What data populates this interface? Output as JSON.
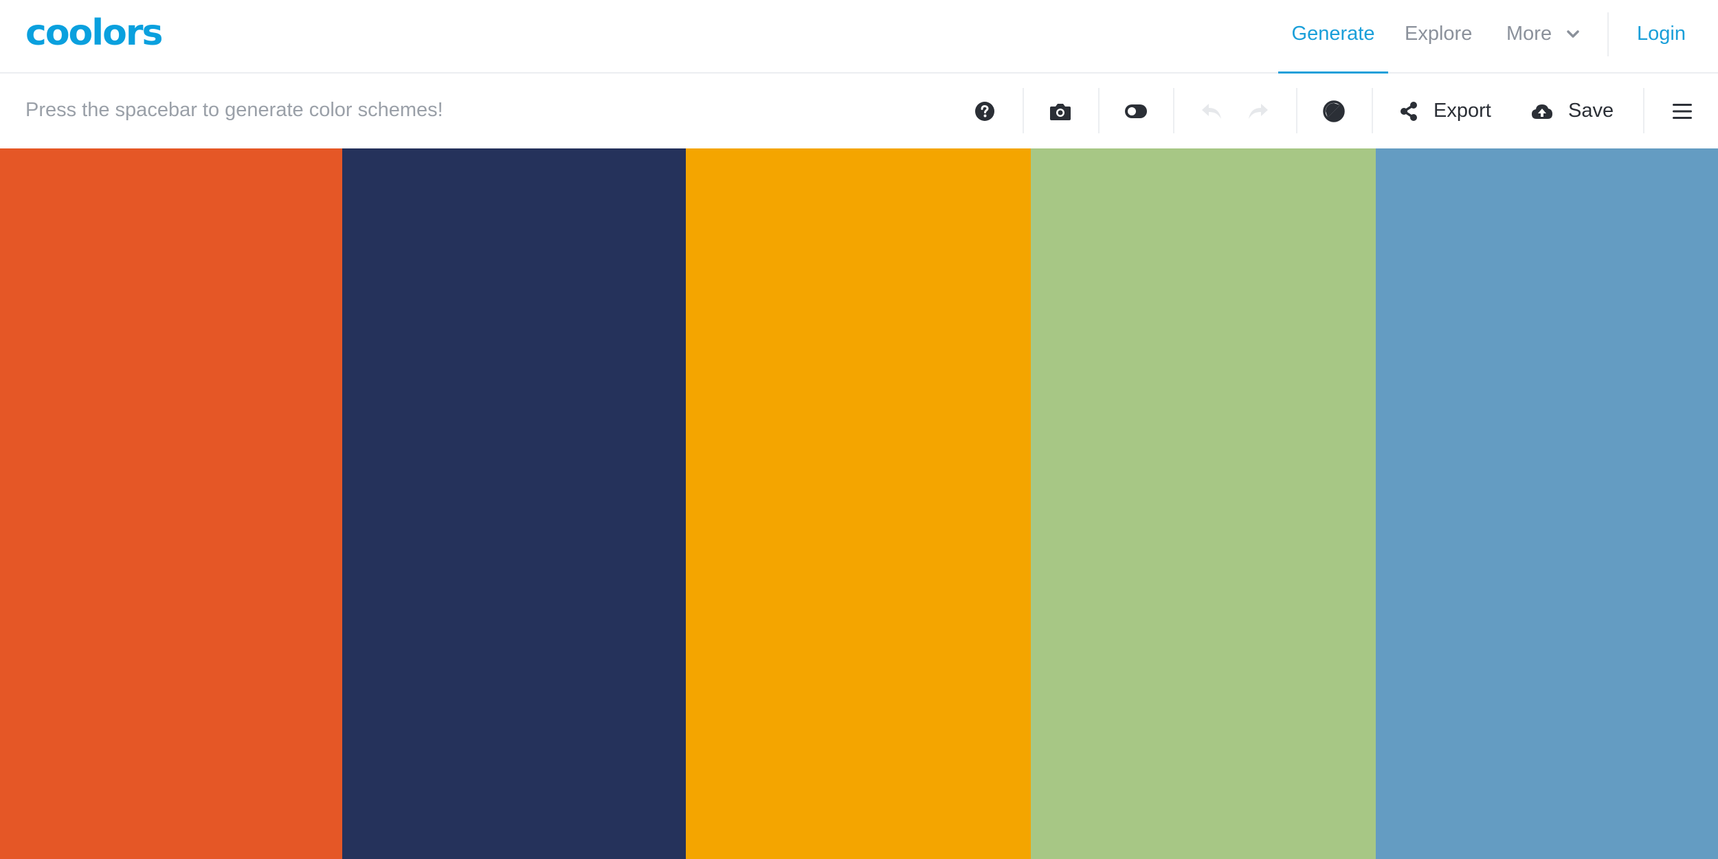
{
  "logo": {
    "text": "coolors",
    "color": "#0aa0de"
  },
  "nav": {
    "generate": "Generate",
    "explore": "Explore",
    "more": "More",
    "login": "Login",
    "active": "Generate",
    "accent": "#1a9fd9"
  },
  "toolbar": {
    "hint": "Press the spacebar to generate color schemes!",
    "icons": [
      "help-icon",
      "camera-icon",
      "toggle-icon",
      "undo-icon",
      "redo-icon",
      "contrast-icon",
      "share-icon",
      "cloud-upload-icon",
      "hamburger-menu-icon"
    ],
    "export_label": "Export",
    "save_label": "Save",
    "undo_enabled": false,
    "redo_enabled": false
  },
  "palette": {
    "colors": [
      "#E55726",
      "#25325B",
      "#F4A500",
      "#A7C785",
      "#649CC2"
    ]
  }
}
